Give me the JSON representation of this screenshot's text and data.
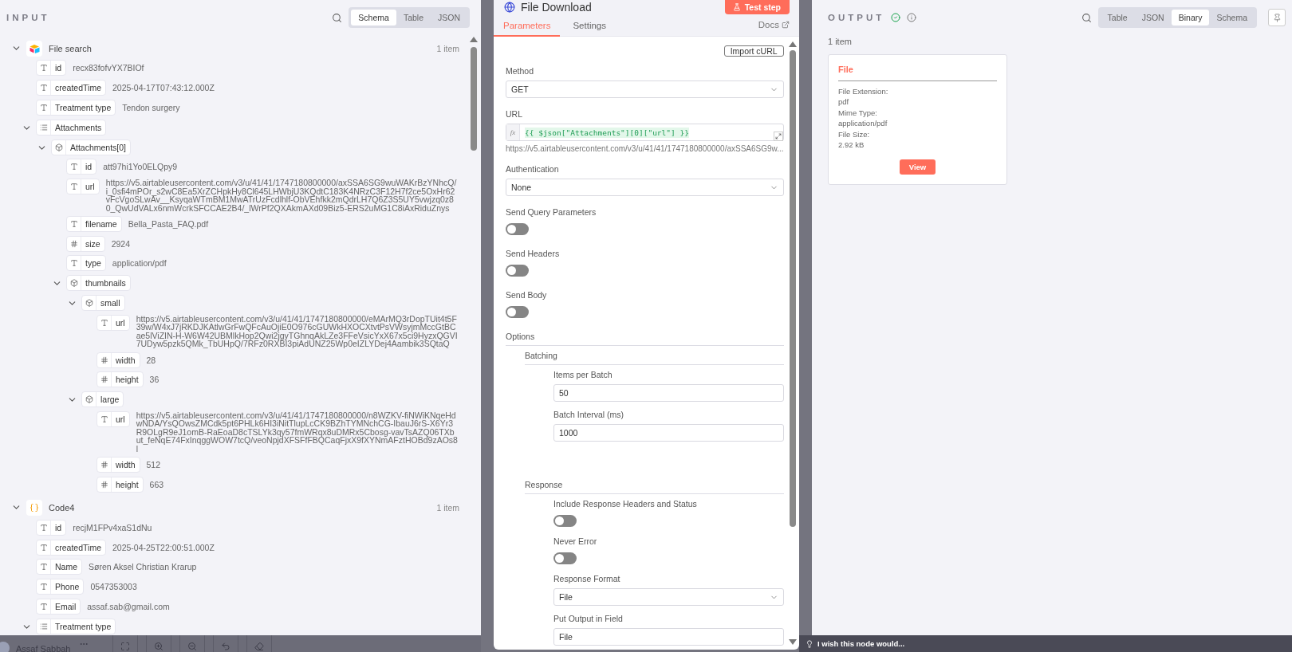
{
  "input": {
    "title": "INPUT",
    "views": [
      {
        "label": "Schema",
        "selected": true
      },
      {
        "label": "Table",
        "selected": false
      },
      {
        "label": "JSON",
        "selected": false
      }
    ],
    "nodes": [
      {
        "name": "File search",
        "count": "1 item",
        "expanded": true,
        "fields": [
          {
            "kind": "string",
            "key": "id",
            "value": "recx83fofvYX7BIOf"
          },
          {
            "kind": "string",
            "key": "createdTime",
            "value": "2025-04-17T07:43:12.000Z"
          },
          {
            "kind": "string",
            "key": "Treatment type",
            "value": "Tendon surgery"
          },
          {
            "kind": "array",
            "key": "Attachments",
            "expanded": true,
            "children": [
              {
                "kind": "object",
                "key": "Attachments[0]",
                "expanded": true,
                "children": [
                  {
                    "kind": "string",
                    "key": "id",
                    "value": "att97hi1Yo0ELQpy9"
                  },
                  {
                    "kind": "string",
                    "key": "url",
                    "value": "https://v5.airtableusercontent.com/v3/u/41/41/1747180800000/axSSA6SG9wuWAKrBzYNhcQ/i_0sfi4mPOr_s2wC8Ea5XrZCHpkHy8Cl645LHWbjU3KQdtC183K4NRzC3F12H7f2ce5OxHr62vFcVgoSLwAv__KsyqaWTmBM1MwATrUzFcdlhlf-ObVEhfkk2mQdrLH7Q6Z3S5UY5vwjzq0z80_QwUdVALx6nmWcrkSFCCAE2B4/_lWrPf2QXAkmAXd09Biz5-ERS2uMG1C8iAxRiduZnys"
                  },
                  {
                    "kind": "string",
                    "key": "filename",
                    "value": "Bella_Pasta_FAQ.pdf"
                  },
                  {
                    "kind": "number",
                    "key": "size",
                    "value": "2924"
                  },
                  {
                    "kind": "string",
                    "key": "type",
                    "value": "application/pdf"
                  },
                  {
                    "kind": "object",
                    "key": "thumbnails",
                    "expanded": true,
                    "children": [
                      {
                        "kind": "object",
                        "key": "small",
                        "expanded": true,
                        "children": [
                          {
                            "kind": "string",
                            "key": "url",
                            "value": "https://v5.airtableusercontent.com/v3/u/41/41/1747180800000/eMArMQ3rDopTUit4t5F39w/W4xJ7jRKDJKAtlwGrFwQFcAuOjiE0O976cGUWkHXOCXtvtPsVWsyjmMccGtBCae5lViZIN-H-W6W42UBMlkHop2Qwi2jgyTGhnqAkLZe3FFeVsicYxX67x5ci9HyzxQGVI7UDyw5pzk5QMk_TbUHpQ/7RFz0RXBI3piAdUNZ25Wp0eIZLYDej4Aambik3SQtaQ"
                          },
                          {
                            "kind": "number",
                            "key": "width",
                            "value": "28"
                          },
                          {
                            "kind": "number",
                            "key": "height",
                            "value": "36"
                          }
                        ]
                      },
                      {
                        "kind": "object",
                        "key": "large",
                        "expanded": true,
                        "children": [
                          {
                            "kind": "string",
                            "key": "url",
                            "value": "https://v5.airtableusercontent.com/v3/u/41/41/1747180800000/n8WZKV-fiNWiKNqeHdwNDA/YsQOwsZMCdk5pt6PHLk6HI3iNitTlupLcCK9BZhTYMNchCG-IbauJ6rS-X6Yr3R9OLgR9eJ1omB-RaEoaD8cTSLYk3qy57fmWRqx8uDMRx5Cbosg-vavTsAZQ06TXbut_feNqE74FxInqggWOW7tcQ/veoNpjdXFSFfFBQCaqFjxX9fXYNmAFztHOBd9zAOs8l"
                          },
                          {
                            "kind": "number",
                            "key": "width",
                            "value": "512"
                          },
                          {
                            "kind": "number",
                            "key": "height",
                            "value": "663"
                          }
                        ]
                      }
                    ]
                  }
                ]
              }
            ]
          }
        ]
      },
      {
        "name": "Code4",
        "count": "1 item",
        "expanded": true,
        "fields": [
          {
            "kind": "string",
            "key": "id",
            "value": "recjM1FPv4xaS1dNu"
          },
          {
            "kind": "string",
            "key": "createdTime",
            "value": "2025-04-25T22:00:51.000Z"
          },
          {
            "kind": "string",
            "key": "Name",
            "value": "Søren Aksel Christian Krarup"
          },
          {
            "kind": "string",
            "key": "Phone",
            "value": "0547353003"
          },
          {
            "kind": "string",
            "key": "Email",
            "value": "assaf.sab@gmail.com"
          },
          {
            "kind": "array",
            "key": "Treatment type",
            "expanded": true
          }
        ]
      }
    ]
  },
  "node": {
    "title": "File Download",
    "test_button": "Test step",
    "tabs": [
      {
        "label": "Parameters",
        "selected": true
      },
      {
        "label": "Settings",
        "selected": false
      }
    ],
    "docs": "Docs",
    "params": [
      {
        "kind": "button",
        "label": "Import cURL"
      },
      {
        "kind": "select",
        "label": "Method",
        "value": "GET"
      },
      {
        "kind": "expression",
        "label": "URL",
        "prefix": "fx",
        "value": "{{ $json[\"Attachments\"][0][\"url\"] }}",
        "hint": "https://v5.airtableusercontent.com/v3/u/41/41/1747180800000/axSSA6SG9w..."
      },
      {
        "kind": "select",
        "label": "Authentication",
        "value": "None"
      },
      {
        "kind": "toggle",
        "label": "Send Query Parameters",
        "on": false
      },
      {
        "kind": "toggle",
        "label": "Send Headers",
        "on": false
      },
      {
        "kind": "toggle",
        "label": "Send Body",
        "on": false
      },
      {
        "kind": "section",
        "label": "Options"
      },
      {
        "kind": "group",
        "label": "Batching",
        "fields": [
          {
            "kind": "input",
            "label": "Items per Batch",
            "value": "50"
          },
          {
            "kind": "input",
            "label": "Batch Interval (ms)",
            "value": "1000"
          }
        ]
      },
      {
        "kind": "group",
        "label": "Response",
        "fields": [
          {
            "kind": "toggle",
            "label": "Include Response Headers and Status",
            "on": false
          },
          {
            "kind": "toggle",
            "label": "Never Error",
            "on": false
          },
          {
            "kind": "select",
            "label": "Response Format",
            "value": "File"
          },
          {
            "kind": "input",
            "label": "Put Output in Field",
            "value": "File"
          }
        ]
      }
    ]
  },
  "output": {
    "title": "OUTPUT",
    "views": [
      {
        "label": "Table",
        "selected": false
      },
      {
        "label": "JSON",
        "selected": false
      },
      {
        "label": "Binary",
        "selected": true
      },
      {
        "label": "Schema",
        "selected": false
      }
    ],
    "count": "1 item",
    "file": {
      "title": "File",
      "props": [
        {
          "label": "File Extension:",
          "value": "pdf"
        },
        {
          "label": "Mime Type:",
          "value": "application/pdf"
        },
        {
          "label": "File Size:",
          "value": "2.92 kB"
        }
      ],
      "button": "View"
    }
  },
  "canvas": {
    "user": "Assaf Sabbah"
  },
  "feedback": "I wish this node would..."
}
